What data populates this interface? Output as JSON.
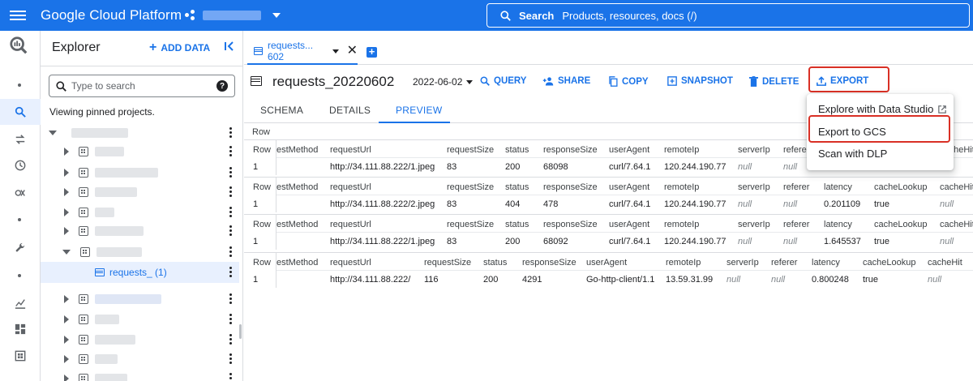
{
  "topbar": {
    "brand": "Google Cloud Platform",
    "search_bold": "Search",
    "search_placeholder": "Products, resources, docs (/)"
  },
  "explorer": {
    "title": "Explorer",
    "add_data": "ADD DATA",
    "search_placeholder": "Type to search",
    "viewing": "Viewing pinned projects.",
    "selected_table_label": "requests_ (1)"
  },
  "tab": {
    "label": "requests... 602"
  },
  "toolbar": {
    "title": "requests_20220602",
    "date": "2022-06-02",
    "query": "QUERY",
    "share": "SHARE",
    "copy": "COPY",
    "snapshot": "SNAPSHOT",
    "delete": "DELETE",
    "export": "EXPORT"
  },
  "subtabs": {
    "schema": "SCHEMA",
    "details": "DETAILS",
    "preview": "PREVIEW"
  },
  "preview": {
    "row_header": "Row",
    "rows": [
      {
        "headers": [
          "Row",
          "estMethod",
          "requestUrl",
          "requestSize",
          "status",
          "responseSize",
          "userAgent",
          "remoteIp",
          "serverIp",
          "referer",
          "latency",
          "cacheLookup",
          "cacheHit"
        ],
        "values": [
          "1",
          "",
          "http://34.111.88.222/1.jpeg",
          "83",
          "200",
          "68098",
          "curl/7.64.1",
          "120.244.190.77",
          "null",
          "null",
          "",
          "",
          ""
        ]
      },
      {
        "headers": [
          "Row",
          "estMethod",
          "requestUrl",
          "requestSize",
          "status",
          "responseSize",
          "userAgent",
          "remoteIp",
          "serverIp",
          "referer",
          "latency",
          "cacheLookup",
          "cacheHit"
        ],
        "values": [
          "1",
          "",
          "http://34.111.88.222/2.jpeg",
          "83",
          "404",
          "478",
          "curl/7.64.1",
          "120.244.190.77",
          "null",
          "null",
          "0.201109",
          "true",
          "null"
        ]
      },
      {
        "headers": [
          "Row",
          "estMethod",
          "requestUrl",
          "requestSize",
          "status",
          "responseSize",
          "userAgent",
          "remoteIp",
          "serverIp",
          "referer",
          "latency",
          "cacheLookup",
          "cacheHit"
        ],
        "values": [
          "1",
          "",
          "http://34.111.88.222/1.jpeg",
          "83",
          "200",
          "68092",
          "curl/7.64.1",
          "120.244.190.77",
          "null",
          "null",
          "1.645537",
          "true",
          "null"
        ]
      },
      {
        "headers": [
          "Row",
          "estMethod",
          "requestUrl",
          "requestSize",
          "status",
          "responseSize",
          "userAgent",
          "remoteIp",
          "serverIp",
          "referer",
          "latency",
          "cacheLookup",
          "cacheHit"
        ],
        "values": [
          "1",
          "",
          "http://34.111.88.222/",
          "116",
          "200",
          "4291",
          "Go-http-client/1.1",
          "13.59.31.99",
          "null",
          "null",
          "0.800248",
          "true",
          "null"
        ]
      }
    ]
  },
  "export_menu": {
    "items": [
      "Explore with Data Studio",
      "Export to GCS",
      "Scan with DLP"
    ]
  },
  "colors": {
    "brand_blue": "#1a73e8",
    "highlight_red": "#d93025"
  }
}
